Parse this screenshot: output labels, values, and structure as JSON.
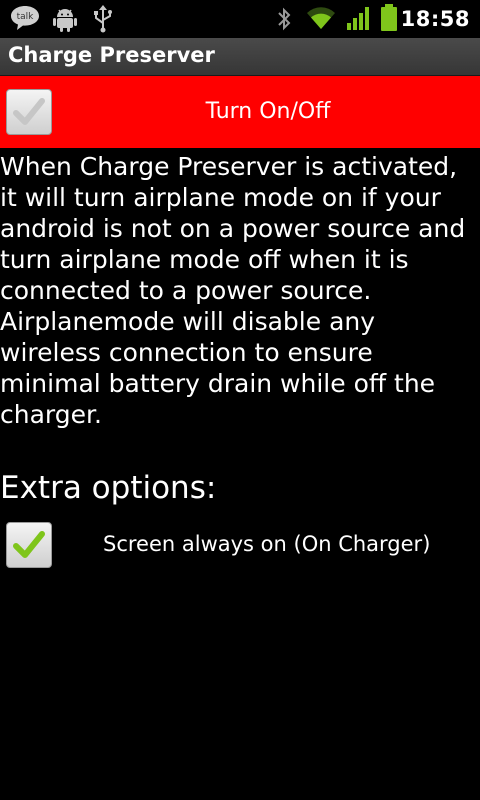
{
  "status_bar": {
    "time": "18:58",
    "talk_label": "talk",
    "left_icons": [
      "talk-icon",
      "android-debug-icon",
      "usb-icon"
    ],
    "right_icons": [
      "bluetooth-icon",
      "wifi-icon",
      "signal-icon",
      "battery-icon"
    ]
  },
  "app": {
    "title": "Charge Preserver"
  },
  "toggle": {
    "label": "Turn On/Off",
    "checked": false,
    "background": "#ff0000"
  },
  "description": "When Charge Preserver is activated, it will turn airplane mode on if your android is not on a power source and turn airplane mode off when it is connected to a power source. Airplanemode will disable any wireless connection to ensure minimal battery drain while off the charger.",
  "extra_options": {
    "heading": "Extra options:",
    "items": [
      {
        "label": "Screen always on (On Charger)",
        "checked": true
      }
    ]
  },
  "colors": {
    "accent_green": "#7fc51b",
    "background": "#000000"
  }
}
